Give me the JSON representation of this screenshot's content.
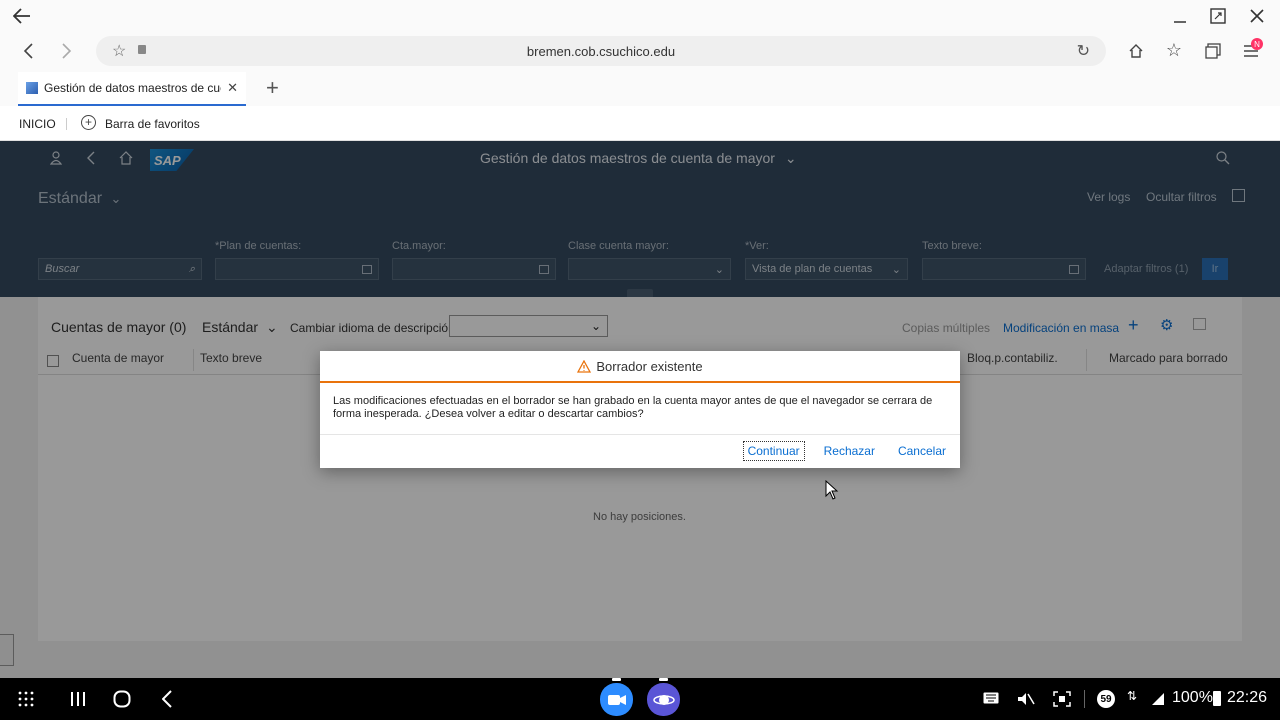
{
  "browser": {
    "url": "bremen.cob.csuchico.edu",
    "tab_title": "Gestión de datos maestros de cue...",
    "tab_close": "✕",
    "new_tab": "+",
    "bookmarks": {
      "inicio": "INICIO",
      "favorites_bar": "Barra de favoritos"
    },
    "update_badge": "N"
  },
  "sap": {
    "logo": "SAP",
    "app_title": "Gestión de datos maestros de cuenta de mayor",
    "variant": "Estándar",
    "header_links": {
      "ver_logs": "Ver logs",
      "ocultar_filtros": "Ocultar filtros"
    },
    "filters": {
      "search_placeholder": "Buscar",
      "plan_label": "*Plan de cuentas:",
      "cta_label": "Cta.mayor:",
      "clase_label": "Clase cuenta mayor:",
      "ver_label": "*Ver:",
      "ver_value": "Vista de plan de cuentas",
      "texto_label": "Texto breve:",
      "adapt": "Adaptar filtros (1)",
      "go": "Ir"
    },
    "table": {
      "title": "Cuentas de mayor (0)",
      "variant": "Estándar",
      "lang_label": "Cambiar idioma de descripción:",
      "copies": "Copias múltiples",
      "mass_edit": "Modificación en masa",
      "columns": [
        "Cuenta de mayor",
        "Texto breve",
        "Bloq.p.contabiliz.",
        "Marcado para borrado"
      ],
      "empty": "No hay posiciones."
    }
  },
  "dialog": {
    "title": "Borrador existente",
    "message": "Las modificaciones efectuadas en el borrador se han grabado en la cuenta mayor antes de que el navegador se cerrara de forma inesperada. ¿Desea volver a editar o descartar cambios?",
    "buttons": {
      "continue": "Continuar",
      "reject": "Rechazar",
      "cancel": "Cancelar"
    },
    "warning_color": "#e9730c"
  },
  "statusbar": {
    "notification_count": "59",
    "battery": "100%",
    "time": "22:26"
  }
}
